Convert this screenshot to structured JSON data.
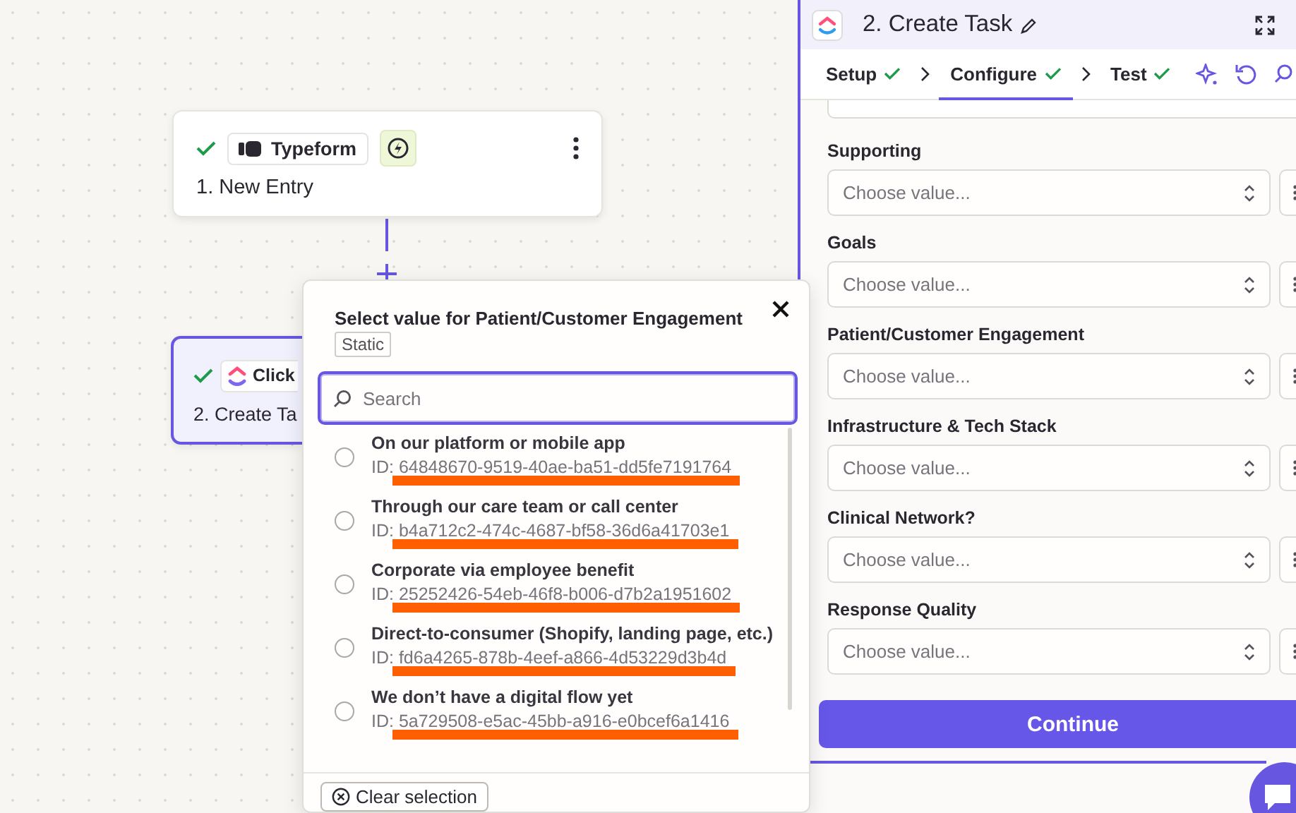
{
  "canvas": {
    "nodes": [
      {
        "kind": "typeform",
        "app": "Typeform",
        "step": "1. New Entry",
        "checked": true,
        "selected": false,
        "trigger": true
      },
      {
        "kind": "clickup",
        "app": "Click",
        "step": "2. Create Ta",
        "checked": true,
        "selected": true
      }
    ]
  },
  "picker": {
    "title": "Select value for Patient/Customer Engagement",
    "badge": "Static",
    "search": {
      "placeholder": "Search"
    },
    "options": [
      {
        "label": "On our platform or mobile app",
        "id": "ID: 64848670-9519-40ae-ba51-dd5fe7191764",
        "selected": false
      },
      {
        "label": "Through our care team or call center",
        "id": "ID: b4a712c2-474c-4687-bf58-36d6a41703e1",
        "selected": false
      },
      {
        "label": "Corporate via employee benefit",
        "id": "ID: 25252426-54eb-46f8-b006-d7b2a1951602",
        "selected": false
      },
      {
        "label": "Direct-to-consumer (Shopify, landing page, etc.)",
        "id": "ID: fd6a4265-878b-4eef-a866-4d53229d3b4d",
        "selected": false
      },
      {
        "label": "We don’t have a digital flow yet",
        "id": "ID: 5a729508-e5ac-45bb-a916-e0bcef6a1416",
        "selected": false
      }
    ],
    "clear_button": "Clear selection"
  },
  "panel": {
    "title": "2. Create Task",
    "tabs": [
      {
        "label": "Setup",
        "done": true,
        "selected": false
      },
      {
        "label": "Configure",
        "done": true,
        "selected": true
      },
      {
        "label": "Test",
        "done": true,
        "selected": false
      }
    ],
    "fields": [
      {
        "label": "Supporting",
        "placeholder": "Choose value..."
      },
      {
        "label": "Goals",
        "placeholder": "Choose value..."
      },
      {
        "label": "Patient/Customer Engagement",
        "placeholder": "Choose value..."
      },
      {
        "label": "Infrastructure & Tech Stack",
        "placeholder": "Choose value..."
      },
      {
        "label": "Clinical Network?",
        "placeholder": "Choose value..."
      },
      {
        "label": "Response Quality",
        "placeholder": "Choose value..."
      }
    ],
    "continue_button": "Continue"
  }
}
